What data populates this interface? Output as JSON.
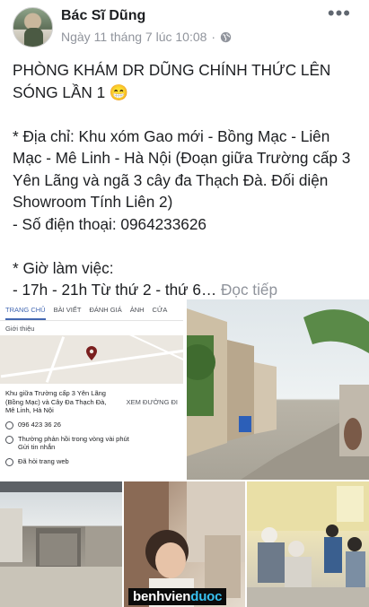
{
  "post": {
    "author": "Bác Sĩ Dũng",
    "timestamp": "Ngày 11 tháng 7 lúc 10:08",
    "separator": "·",
    "privacy_icon": "globe-icon",
    "more_icon": "more-horizontal-icon",
    "avatar_icon": "avatar",
    "body": {
      "headline": "PHÒNG KHÁM DR DŨNG CHÍNH THỨC LÊN SÓNG LẦN 1 😁",
      "address": "* Địa chỉ: Khu xóm Gao mới - Bồng Mạc - Liên Mạc - Mê Linh - Hà Nội (Đoạn giữa Trường cấp 3 Yên Lãng và ngã 3 cây đa Thạch Đà. Đối diện Showroom Tính Liên 2)",
      "phone": "- Số điện thoại: 0964233626",
      "hours_title": "* Giờ làm việc:",
      "hours_line": "- 17h - 21h Từ thứ 2 - thứ 6…",
      "see_more": "Đọc tiếp"
    }
  },
  "photos": {
    "page_screenshot": {
      "tabs": [
        "TRANG CHỦ",
        "BÀI VIẾT",
        "ĐÁNH GIÁ",
        "ẢNH",
        "CỬA"
      ],
      "active_tab": 0,
      "intro_label": "Giới thiệu",
      "address": "Khu giữa Trường cấp 3 Yên Lãng (Bồng Mạc) và Cây Đa Thạch Đà, Mê Linh, Hà Nội",
      "directions": "XEM ĐƯỜNG ĐI",
      "phone": "096 423 36 26",
      "response": "Thường phản hồi trong vòng vài phút",
      "message": "Gửi tin nhắn",
      "web": "Đã hỏi trang web"
    },
    "street_photo": "street-photo",
    "garage_photo": "garage-photo",
    "child_photo": "child-photo",
    "waiting_room_photo": "waiting-room-photo"
  },
  "watermark": {
    "part1": "benhvien",
    "part2": "duoc"
  },
  "colors": {
    "link": "#4267b2",
    "muted": "#90949c",
    "watermark_accent": "#38c0ef"
  }
}
